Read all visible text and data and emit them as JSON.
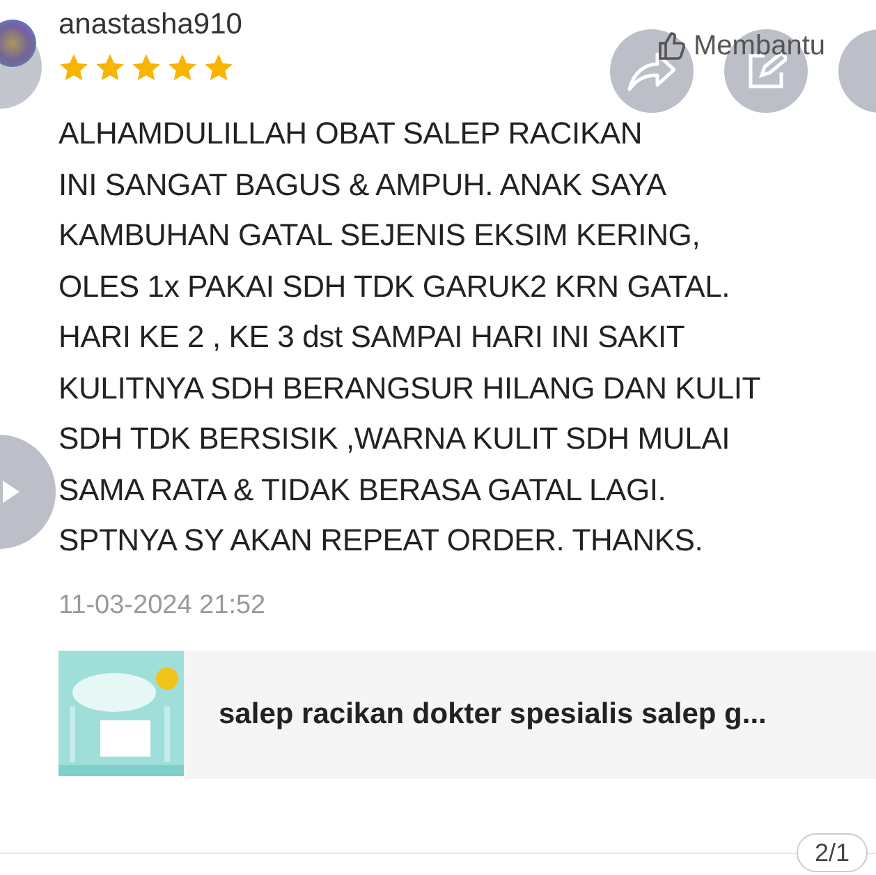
{
  "review": {
    "username": "anastasha910",
    "stars": 5,
    "helpful_label": "Membantu",
    "text": "ALHAMDULILLAH OBAT SALEP RACIKAN\nINI SANGAT BAGUS & AMPUH. ANAK SAYA\nKAMBUHAN GATAL SEJENIS EKSIM KERING,\nOLES 1x PAKAI SDH TDK GARUK2 KRN GATAL.\nHARI KE 2 , KE 3 dst SAMPAI HARI INI SAKIT\nKULITNYA SDH BERANGSUR HILANG DAN KULIT\nSDH TDK BERSISIK ,WARNA KULIT SDH MULAI\nSAMA RATA & TIDAK BERASA GATAL LAGI.\nSPTNYA SY AKAN REPEAT ORDER. THANKS.",
    "date": "11-03-2024 21:52"
  },
  "product": {
    "title": "salep racikan dokter spesialis salep g..."
  },
  "page_indicator": "2/1"
}
